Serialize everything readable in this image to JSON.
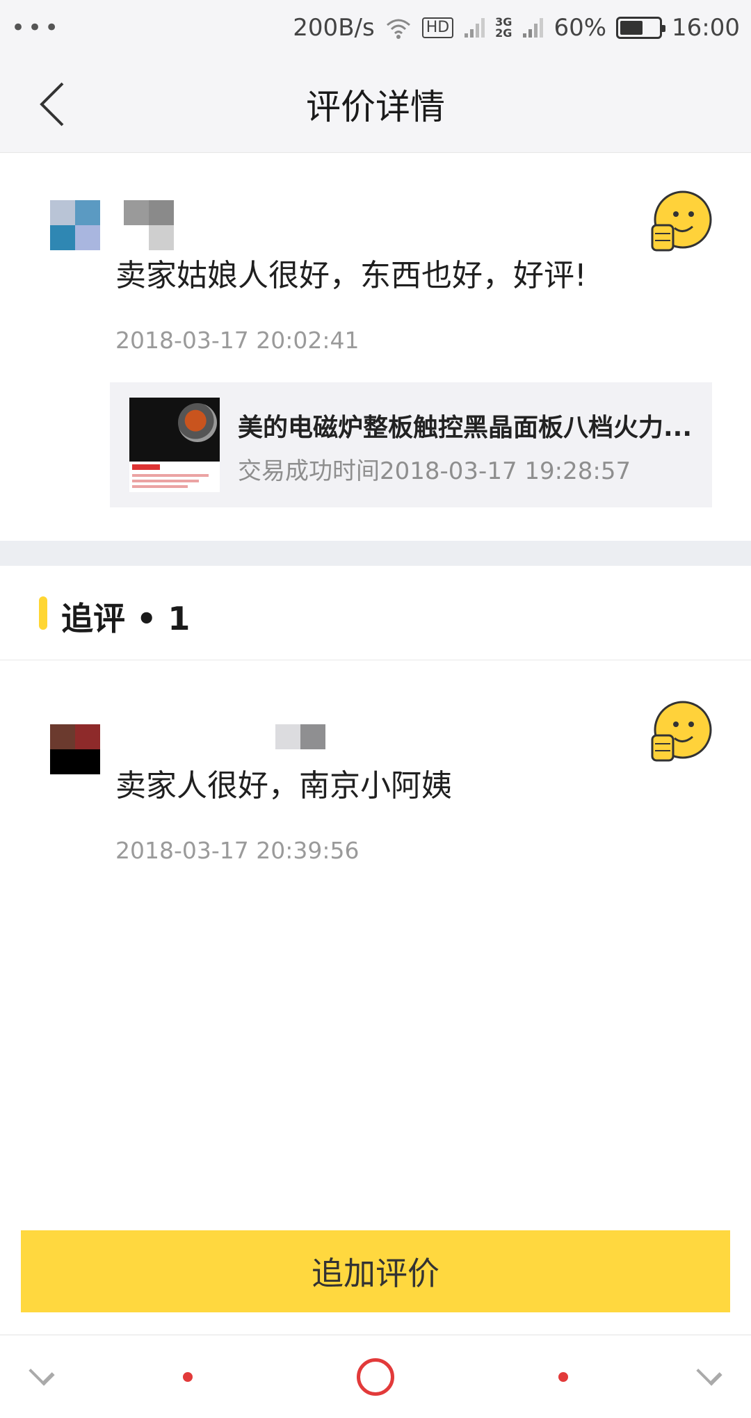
{
  "status_bar": {
    "dots": "•••",
    "speed": "200B/s",
    "hd": "HD",
    "net_top": "3G",
    "net_bottom": "2G",
    "battery_level": 60,
    "battery_text": "60%",
    "time": "16:00"
  },
  "nav": {
    "title": "评价详情"
  },
  "review": {
    "text": "卖家姑娘人很好，东西也好，好评!",
    "time": "2018-03-17 20:02:41",
    "product": {
      "title": "美的电磁炉整板触控黑晶面板八档火力...",
      "trade_time": "交易成功时间2018-03-17 19:28:57"
    }
  },
  "followup_section": {
    "title": "追评 • 1"
  },
  "followup": {
    "text": "卖家人很好，南京小阿姨",
    "time": "2018-03-17 20:39:56"
  },
  "bottom_button": {
    "label": "追加评价"
  },
  "colors": {
    "accent": "#ffd83f",
    "system_nav_red": "#e23a3a"
  }
}
